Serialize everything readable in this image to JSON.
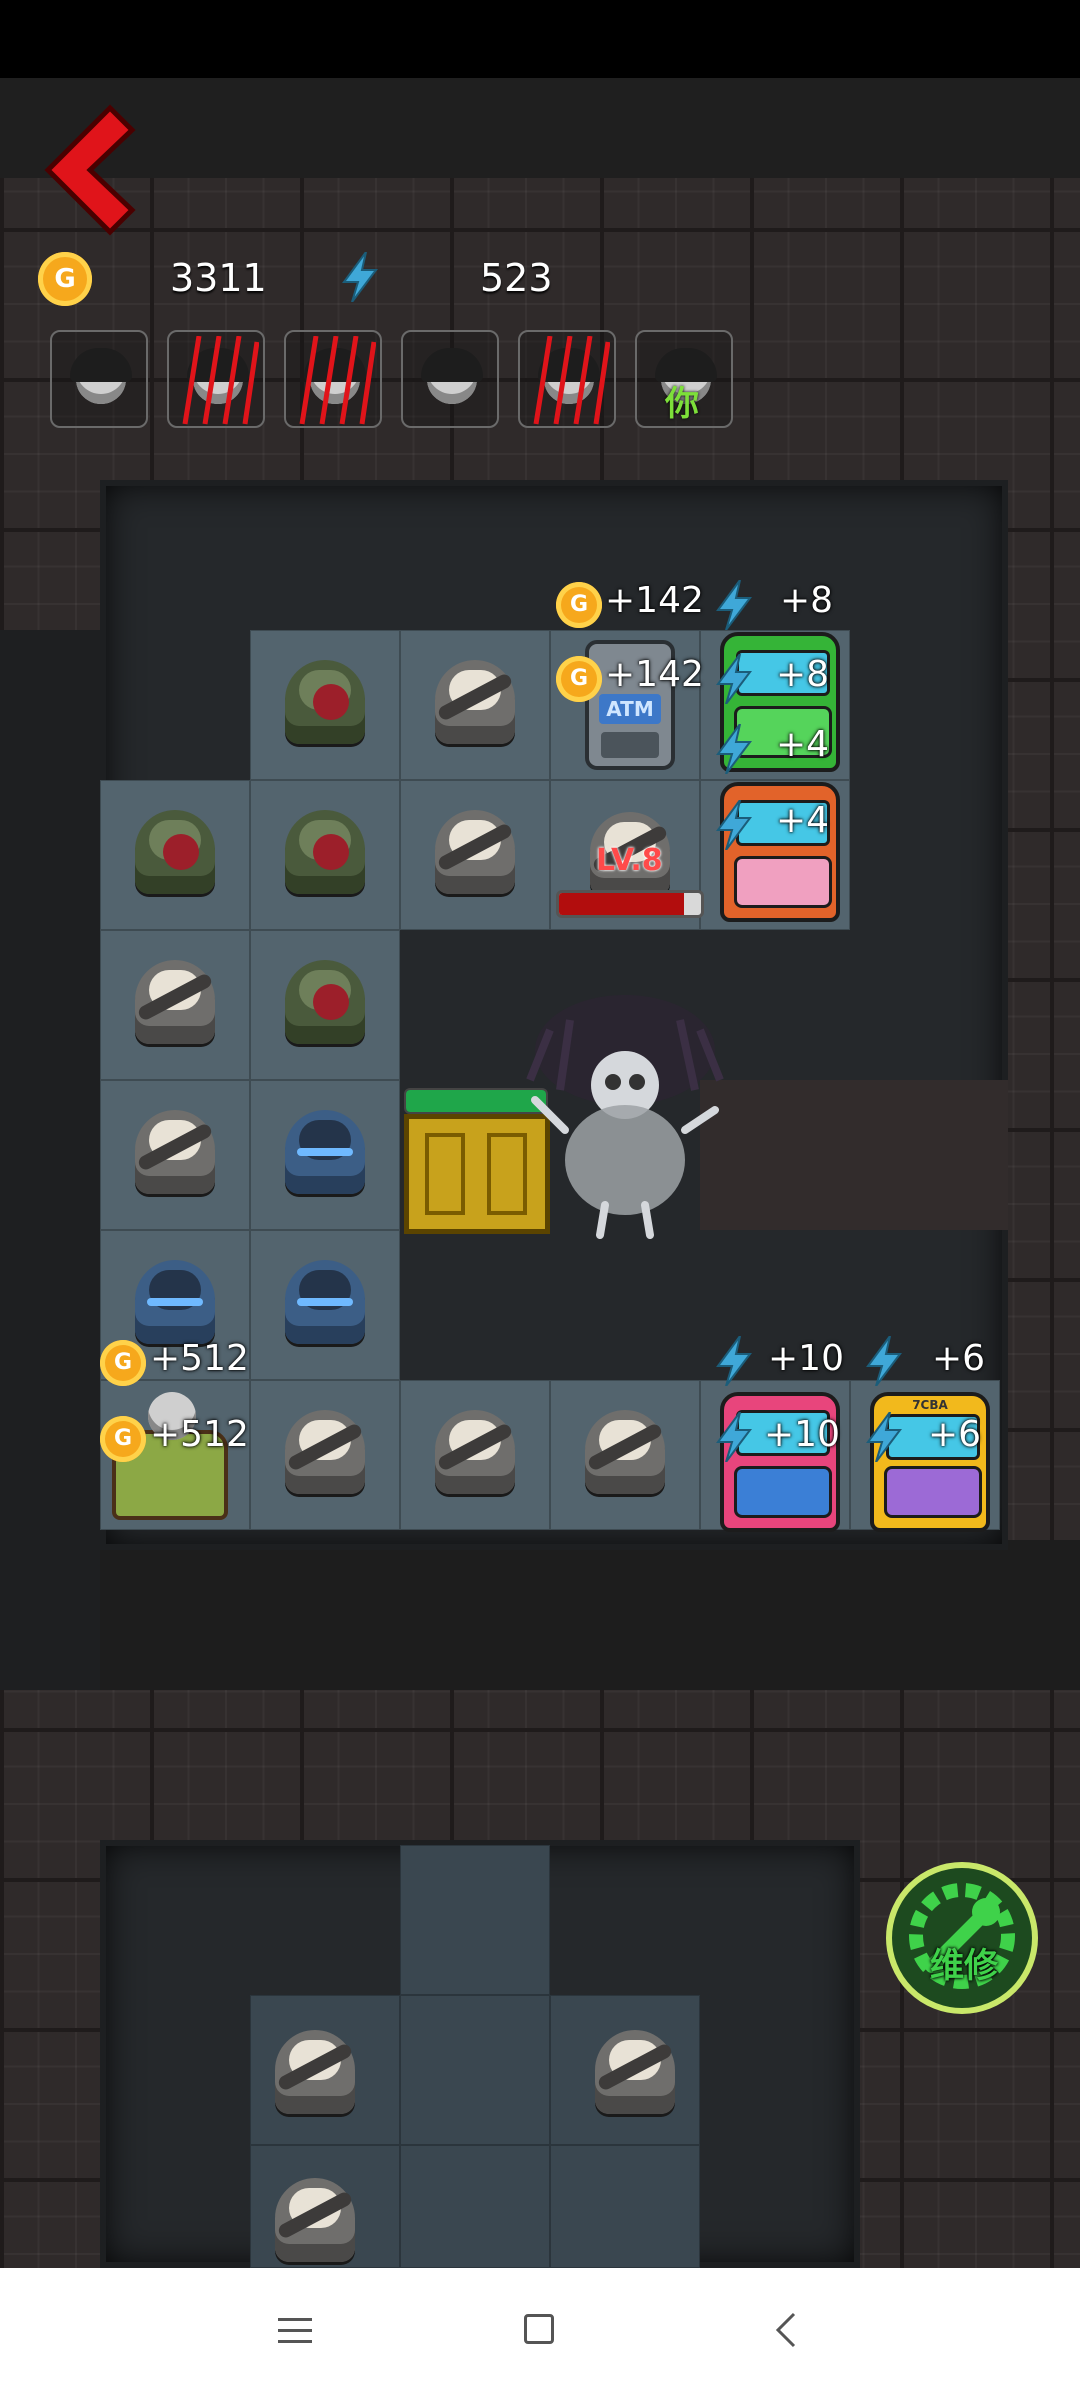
{
  "hud": {
    "gold": "3311",
    "energy": "523",
    "coin_letter": "G"
  },
  "players": [
    {
      "icon": "girl-avatar-icon",
      "state": "alive"
    },
    {
      "icon": "claw-scratch-icon",
      "state": "scratched"
    },
    {
      "icon": "claw-scratch-icon",
      "state": "scratched"
    },
    {
      "icon": "girl-avatar-icon",
      "state": "alive"
    },
    {
      "icon": "claw-scratch-icon",
      "state": "scratched"
    },
    {
      "icon": "girl-avatar-icon",
      "state": "you",
      "label": "你"
    }
  ],
  "gains": {
    "atm_gold_top": "+142",
    "atm_gold": "+142",
    "arcade_green_energy_top": "+8",
    "arcade_green_energy": "+8",
    "arcade_green_energy_low": "+4",
    "arcade_orange_energy": "+4",
    "bed_gold_top": "+512",
    "bed_gold": "+512",
    "arcade_blue_energy_top": "+10",
    "arcade_blue_energy": "+10",
    "arcade_yellow_energy_top": "+6",
    "arcade_yellow_energy": "+6"
  },
  "atm": {
    "label": "ATM"
  },
  "ghost": {
    "level_label": "LV.8",
    "hp_fraction": 0.88,
    "door_hp_fraction": 1.0
  },
  "arcade_yellow": {
    "marquee": "7CBA"
  },
  "repair_button": {
    "label": "维修"
  },
  "colors": {
    "accent_red": "#e0141a",
    "repair_green": "#3fd24a",
    "coin_gold": "#f6a81c",
    "energy_blue": "#3fa8d8"
  },
  "nav": {
    "menu": "menu-icon",
    "home": "home-icon",
    "back": "back-icon"
  }
}
